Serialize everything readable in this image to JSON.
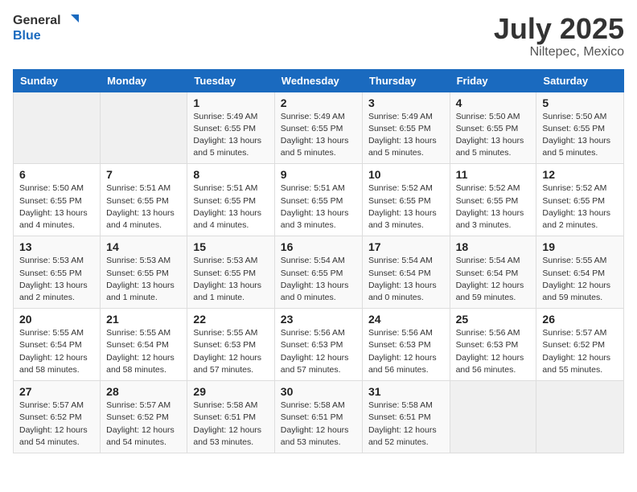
{
  "header": {
    "logo_general": "General",
    "logo_blue": "Blue",
    "month": "July 2025",
    "location": "Niltepec, Mexico"
  },
  "weekdays": [
    "Sunday",
    "Monday",
    "Tuesday",
    "Wednesday",
    "Thursday",
    "Friday",
    "Saturday"
  ],
  "weeks": [
    [
      {
        "day": "",
        "info": ""
      },
      {
        "day": "",
        "info": ""
      },
      {
        "day": "1",
        "info": "Sunrise: 5:49 AM\nSunset: 6:55 PM\nDaylight: 13 hours\nand 5 minutes."
      },
      {
        "day": "2",
        "info": "Sunrise: 5:49 AM\nSunset: 6:55 PM\nDaylight: 13 hours\nand 5 minutes."
      },
      {
        "day": "3",
        "info": "Sunrise: 5:49 AM\nSunset: 6:55 PM\nDaylight: 13 hours\nand 5 minutes."
      },
      {
        "day": "4",
        "info": "Sunrise: 5:50 AM\nSunset: 6:55 PM\nDaylight: 13 hours\nand 5 minutes."
      },
      {
        "day": "5",
        "info": "Sunrise: 5:50 AM\nSunset: 6:55 PM\nDaylight: 13 hours\nand 5 minutes."
      }
    ],
    [
      {
        "day": "6",
        "info": "Sunrise: 5:50 AM\nSunset: 6:55 PM\nDaylight: 13 hours\nand 4 minutes."
      },
      {
        "day": "7",
        "info": "Sunrise: 5:51 AM\nSunset: 6:55 PM\nDaylight: 13 hours\nand 4 minutes."
      },
      {
        "day": "8",
        "info": "Sunrise: 5:51 AM\nSunset: 6:55 PM\nDaylight: 13 hours\nand 4 minutes."
      },
      {
        "day": "9",
        "info": "Sunrise: 5:51 AM\nSunset: 6:55 PM\nDaylight: 13 hours\nand 3 minutes."
      },
      {
        "day": "10",
        "info": "Sunrise: 5:52 AM\nSunset: 6:55 PM\nDaylight: 13 hours\nand 3 minutes."
      },
      {
        "day": "11",
        "info": "Sunrise: 5:52 AM\nSunset: 6:55 PM\nDaylight: 13 hours\nand 3 minutes."
      },
      {
        "day": "12",
        "info": "Sunrise: 5:52 AM\nSunset: 6:55 PM\nDaylight: 13 hours\nand 2 minutes."
      }
    ],
    [
      {
        "day": "13",
        "info": "Sunrise: 5:53 AM\nSunset: 6:55 PM\nDaylight: 13 hours\nand 2 minutes."
      },
      {
        "day": "14",
        "info": "Sunrise: 5:53 AM\nSunset: 6:55 PM\nDaylight: 13 hours\nand 1 minute."
      },
      {
        "day": "15",
        "info": "Sunrise: 5:53 AM\nSunset: 6:55 PM\nDaylight: 13 hours\nand 1 minute."
      },
      {
        "day": "16",
        "info": "Sunrise: 5:54 AM\nSunset: 6:55 PM\nDaylight: 13 hours\nand 0 minutes."
      },
      {
        "day": "17",
        "info": "Sunrise: 5:54 AM\nSunset: 6:54 PM\nDaylight: 13 hours\nand 0 minutes."
      },
      {
        "day": "18",
        "info": "Sunrise: 5:54 AM\nSunset: 6:54 PM\nDaylight: 12 hours\nand 59 minutes."
      },
      {
        "day": "19",
        "info": "Sunrise: 5:55 AM\nSunset: 6:54 PM\nDaylight: 12 hours\nand 59 minutes."
      }
    ],
    [
      {
        "day": "20",
        "info": "Sunrise: 5:55 AM\nSunset: 6:54 PM\nDaylight: 12 hours\nand 58 minutes."
      },
      {
        "day": "21",
        "info": "Sunrise: 5:55 AM\nSunset: 6:54 PM\nDaylight: 12 hours\nand 58 minutes."
      },
      {
        "day": "22",
        "info": "Sunrise: 5:55 AM\nSunset: 6:53 PM\nDaylight: 12 hours\nand 57 minutes."
      },
      {
        "day": "23",
        "info": "Sunrise: 5:56 AM\nSunset: 6:53 PM\nDaylight: 12 hours\nand 57 minutes."
      },
      {
        "day": "24",
        "info": "Sunrise: 5:56 AM\nSunset: 6:53 PM\nDaylight: 12 hours\nand 56 minutes."
      },
      {
        "day": "25",
        "info": "Sunrise: 5:56 AM\nSunset: 6:53 PM\nDaylight: 12 hours\nand 56 minutes."
      },
      {
        "day": "26",
        "info": "Sunrise: 5:57 AM\nSunset: 6:52 PM\nDaylight: 12 hours\nand 55 minutes."
      }
    ],
    [
      {
        "day": "27",
        "info": "Sunrise: 5:57 AM\nSunset: 6:52 PM\nDaylight: 12 hours\nand 54 minutes."
      },
      {
        "day": "28",
        "info": "Sunrise: 5:57 AM\nSunset: 6:52 PM\nDaylight: 12 hours\nand 54 minutes."
      },
      {
        "day": "29",
        "info": "Sunrise: 5:58 AM\nSunset: 6:51 PM\nDaylight: 12 hours\nand 53 minutes."
      },
      {
        "day": "30",
        "info": "Sunrise: 5:58 AM\nSunset: 6:51 PM\nDaylight: 12 hours\nand 53 minutes."
      },
      {
        "day": "31",
        "info": "Sunrise: 5:58 AM\nSunset: 6:51 PM\nDaylight: 12 hours\nand 52 minutes."
      },
      {
        "day": "",
        "info": ""
      },
      {
        "day": "",
        "info": ""
      }
    ]
  ]
}
